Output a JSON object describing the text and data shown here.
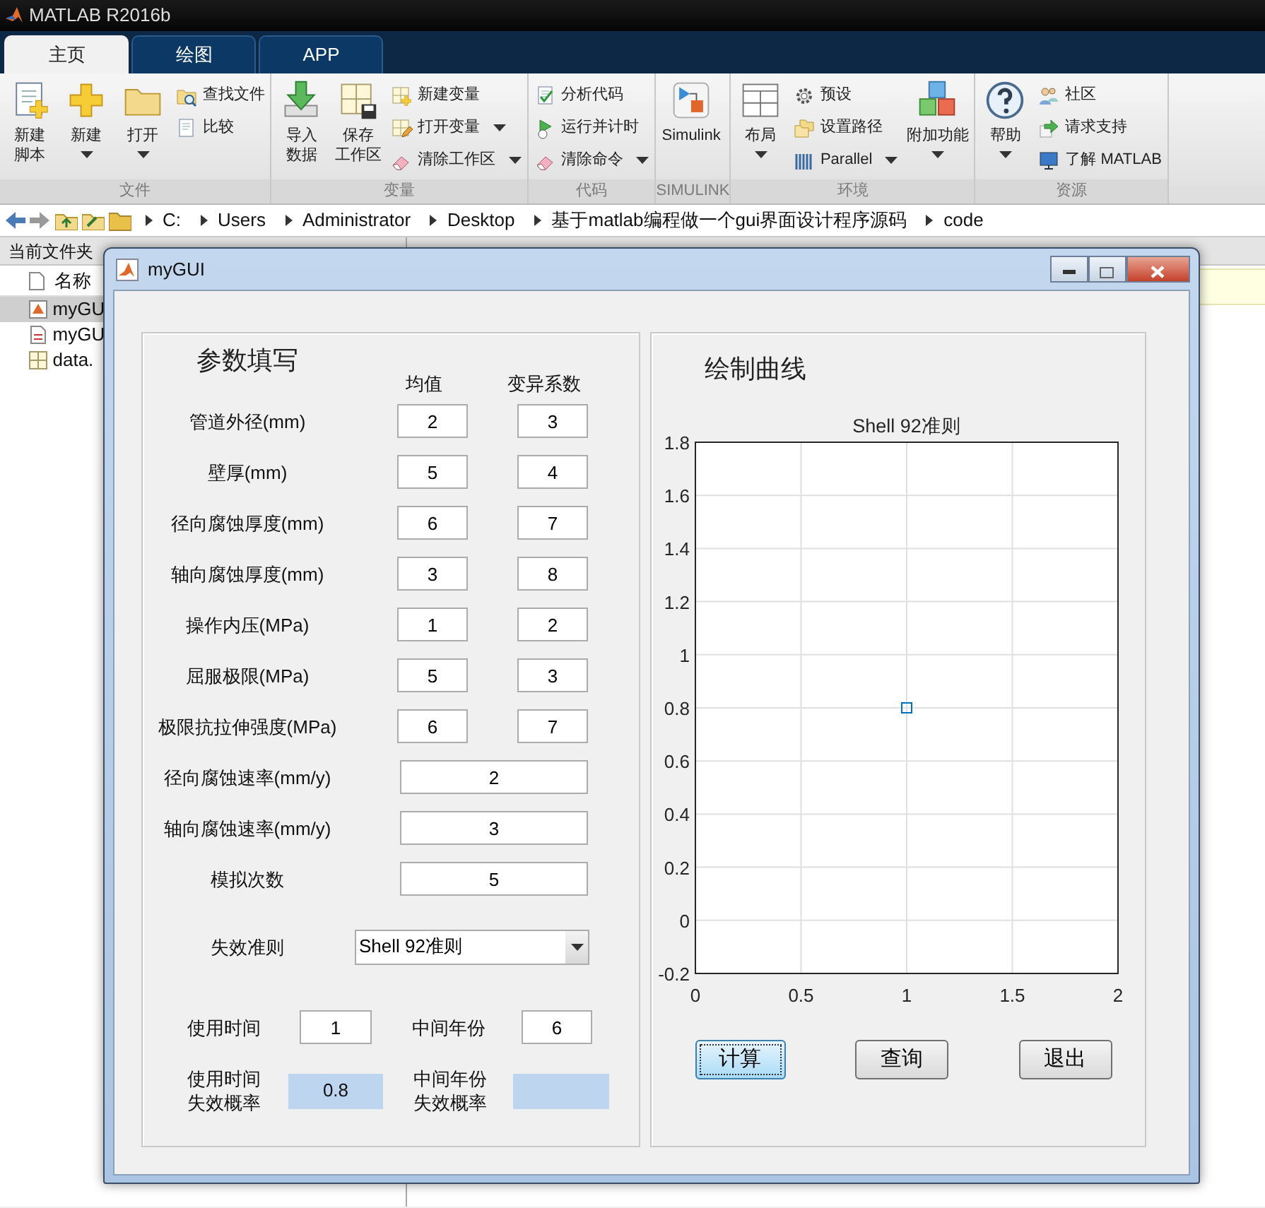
{
  "app_title": "MATLAB R2016b",
  "tabs": [
    {
      "label": "主页",
      "selected": true
    },
    {
      "label": "绘图",
      "selected": false
    },
    {
      "label": "APP",
      "selected": false
    }
  ],
  "ribbon": {
    "groups": [
      {
        "label": "文件",
        "items": [
          {
            "kind": "large",
            "label_lines": [
              "新建",
              "脚本"
            ],
            "dropdown": false
          },
          {
            "kind": "large",
            "label": "新建",
            "dropdown": true
          },
          {
            "kind": "large",
            "label": "打开",
            "dropdown": true
          },
          {
            "kind": "small",
            "label": "查找文件",
            "dropdown": false
          },
          {
            "kind": "small",
            "label": "比较",
            "dropdown": false
          }
        ]
      },
      {
        "label": "变量",
        "items": [
          {
            "kind": "large",
            "label_lines": [
              "导入",
              "数据"
            ],
            "dropdown": false
          },
          {
            "kind": "large",
            "label_lines": [
              "保存",
              "工作区"
            ],
            "dropdown": false
          },
          {
            "kind": "small",
            "label": "新建变量",
            "dropdown": false
          },
          {
            "kind": "small",
            "label": "打开变量",
            "dropdown": true
          },
          {
            "kind": "small",
            "label": "清除工作区",
            "dropdown": true
          }
        ]
      },
      {
        "label": "代码",
        "items": [
          {
            "kind": "small",
            "label": "分析代码",
            "dropdown": false
          },
          {
            "kind": "small",
            "label": "运行并计时",
            "dropdown": false
          },
          {
            "kind": "small",
            "label": "清除命令",
            "dropdown": true
          }
        ]
      },
      {
        "label": "SIMULINK",
        "items": [
          {
            "kind": "large",
            "label": "Simulink",
            "dropdown": false
          }
        ]
      },
      {
        "label": "环境",
        "items": [
          {
            "kind": "large",
            "label": "布局",
            "dropdown": true
          },
          {
            "kind": "small",
            "label": "预设",
            "dropdown": false
          },
          {
            "kind": "small",
            "label": "设置路径",
            "dropdown": false
          },
          {
            "kind": "small",
            "label": "Parallel",
            "dropdown": true
          },
          {
            "kind": "large",
            "label": "附加功能",
            "dropdown": true
          }
        ]
      },
      {
        "label": "资源",
        "items": [
          {
            "kind": "large",
            "label": "帮助",
            "dropdown": true
          },
          {
            "kind": "small",
            "label": "社区",
            "dropdown": false
          },
          {
            "kind": "small",
            "label": "请求支持",
            "dropdown": false
          },
          {
            "kind": "small",
            "label": "了解 MATLAB",
            "dropdown": false
          }
        ]
      }
    ]
  },
  "address_bar": {
    "path": [
      "C:",
      "Users",
      "Administrator",
      "Desktop",
      "基于matlab编程做一个gui界面设计程序源码",
      "code"
    ]
  },
  "current_folder": {
    "title": "当前文件夹",
    "column": "名称",
    "files": [
      {
        "name": "myGU",
        "selected": true
      },
      {
        "name": "myGU",
        "selected": false
      },
      {
        "name": "data.",
        "selected": false
      }
    ]
  },
  "dialog": {
    "title": "myGUI",
    "params_panel": {
      "title": "参数填写",
      "column_headers": [
        "均值",
        "变异系数"
      ],
      "paired_rows": [
        {
          "label": "管道外径(mm)",
          "mean": "2",
          "cv": "3"
        },
        {
          "label": "壁厚(mm)",
          "mean": "5",
          "cv": "4"
        },
        {
          "label": "径向腐蚀厚度(mm)",
          "mean": "6",
          "cv": "7"
        },
        {
          "label": "轴向腐蚀厚度(mm)",
          "mean": "3",
          "cv": "8"
        },
        {
          "label": "操作内压(MPa)",
          "mean": "1",
          "cv": "2"
        },
        {
          "label": "屈服极限(MPa)",
          "mean": "5",
          "cv": "3"
        },
        {
          "label": "极限抗拉伸强度(MPa)",
          "mean": "6",
          "cv": "7"
        }
      ],
      "single_rows": [
        {
          "label": "径向腐蚀速率(mm/y)",
          "value": "2"
        },
        {
          "label": "轴向腐蚀速率(mm/y)",
          "value": "3"
        },
        {
          "label": "模拟次数",
          "value": "5"
        }
      ],
      "criterion": {
        "label": "失效准则",
        "value": "Shell 92准则"
      },
      "time_inputs": [
        {
          "label": "使用时间",
          "value": "1"
        },
        {
          "label": "中间年份",
          "value": "6"
        }
      ],
      "probabilities": [
        {
          "label_lines": [
            "使用时间",
            "失效概率"
          ],
          "value": "0.8"
        },
        {
          "label_lines": [
            "中间年份",
            "失效概率"
          ]
        }
      ]
    },
    "plot_panel": {
      "title": "绘制曲线",
      "chart_data": {
        "type": "scatter",
        "title": "Shell 92准则",
        "x": [
          1
        ],
        "series": [
          {
            "color": "#0072bd",
            "values": [
              0.8
            ]
          }
        ],
        "grid": true,
        "xlim": [
          0,
          2
        ],
        "ylim": [
          -0.2,
          1.8
        ],
        "xticks": [
          0,
          0.5,
          1,
          1.5,
          2
        ],
        "yticks": [
          -0.2,
          0,
          0.2,
          0.4,
          0.6,
          0.8,
          1,
          1.2,
          1.4,
          1.6,
          1.8
        ]
      },
      "buttons": [
        {
          "label": "计算",
          "focused": true
        },
        {
          "label": "查询",
          "focused": false
        },
        {
          "label": "退出",
          "focused": false
        }
      ]
    }
  }
}
